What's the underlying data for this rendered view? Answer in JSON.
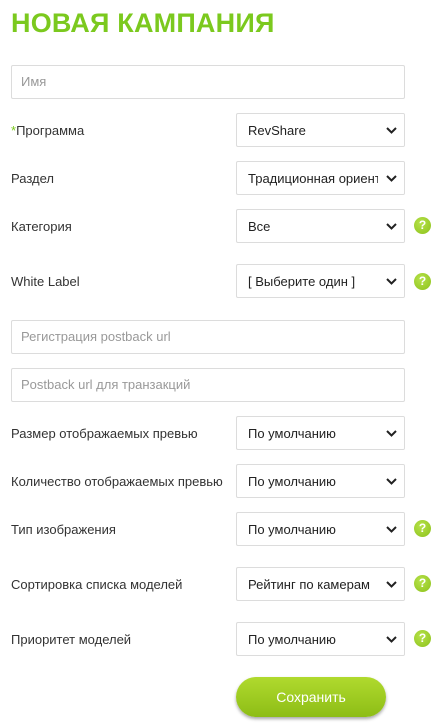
{
  "page": {
    "title": "НОВАЯ КАМПАНИЯ"
  },
  "form": {
    "name_placeholder": "Имя",
    "program": {
      "required_mark": "*",
      "label": "Программа",
      "value": "RevShare"
    },
    "section": {
      "label": "Раздел",
      "value": "Традиционная ориентация"
    },
    "category": {
      "label": "Категория",
      "value": "Все"
    },
    "white_label": {
      "label": "White Label",
      "value": "[ Выберите один ]"
    },
    "reg_postback_placeholder": "Регистрация postback url",
    "tx_postback_placeholder": "Postback url для транзакций",
    "preview_size": {
      "label": "Размер отображаемых превью",
      "value": "По умолчанию"
    },
    "preview_count": {
      "label": "Количество отображаемых превью",
      "value": "По умолчанию"
    },
    "image_type": {
      "label": "Тип изображения",
      "value": "По умолчанию"
    },
    "model_sort": {
      "label": "Сортировка списка моделей",
      "value": "Рейтинг по камерам"
    },
    "model_priority": {
      "label": "Приоритет моделей",
      "value": "По умолчанию"
    },
    "help_glyph": "?",
    "save_label": "Сохранить"
  },
  "colors": {
    "accent": "#7bc91e",
    "button": "#9acb22"
  },
  "icons": {
    "select_arrow": "chevron-down-icon",
    "help": "help-icon"
  }
}
